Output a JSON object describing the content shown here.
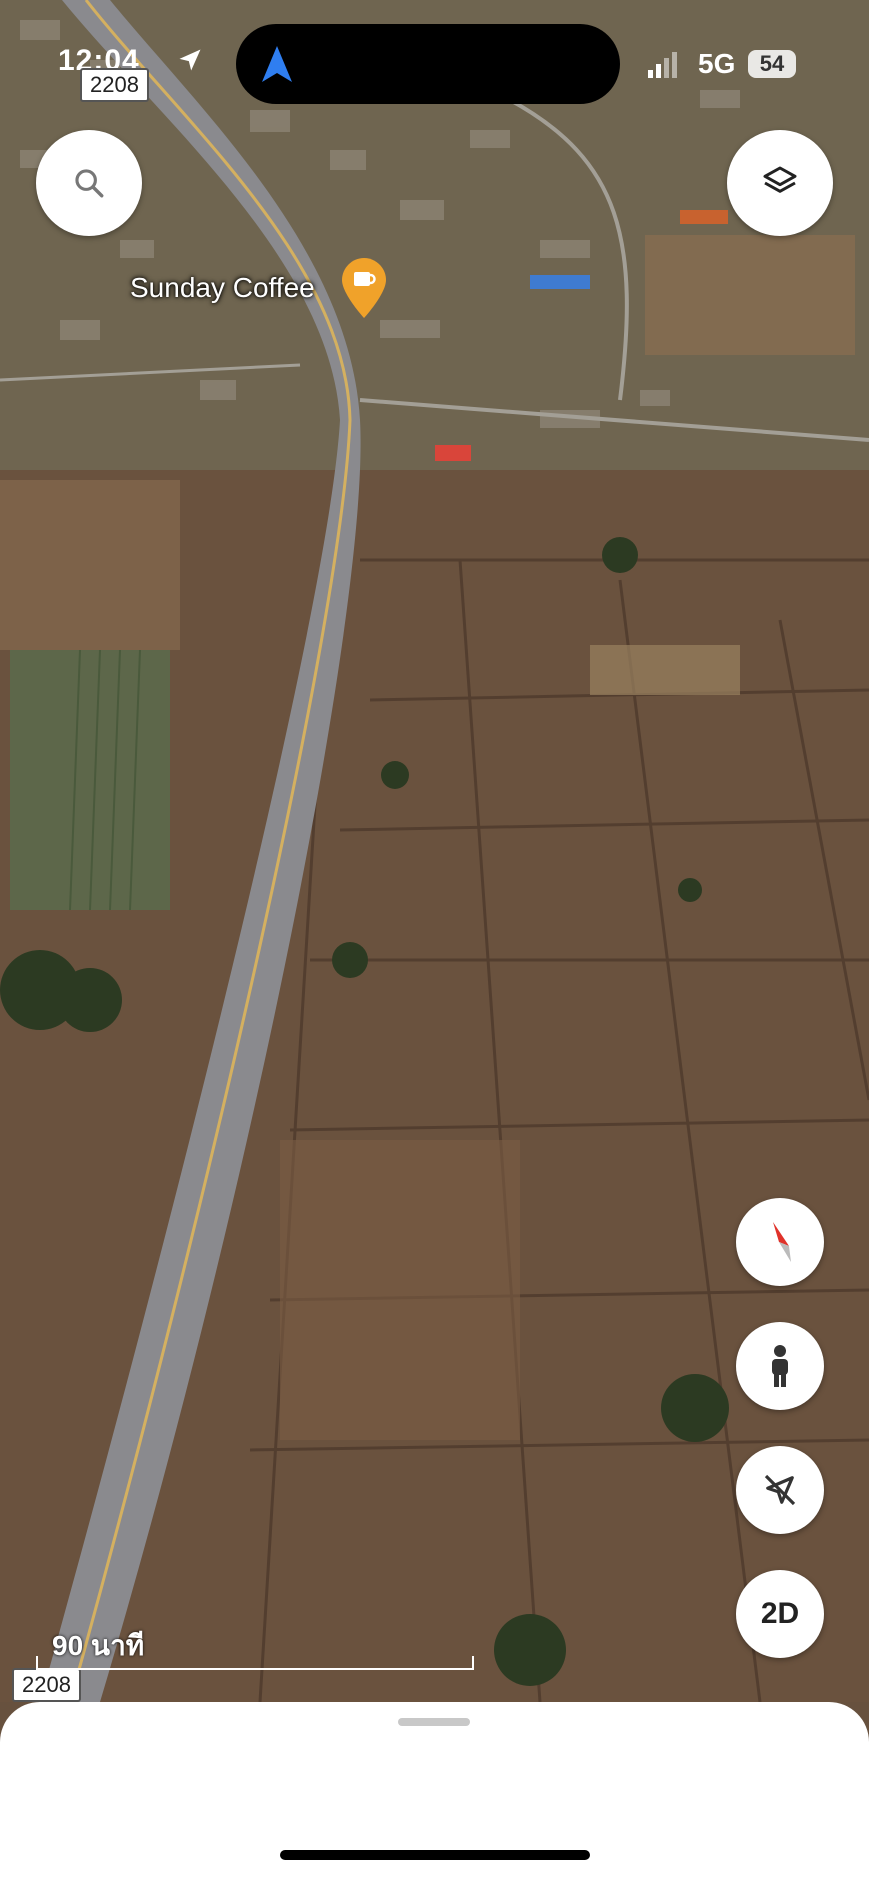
{
  "status_bar": {
    "time": "12:04",
    "network": "5G",
    "battery": "54"
  },
  "map": {
    "road_shield_top": "2208",
    "road_shield_bottom": "2208",
    "poi": {
      "name": "Sunday Coffee",
      "icon": "coffee-cup-icon"
    },
    "scale_label": "90 นาที"
  },
  "controls": {
    "search_icon": "search-icon",
    "layers_icon": "layers-icon",
    "compass_icon": "compass-icon",
    "street_view_icon": "pegman-icon",
    "location_icon": "location-off-icon",
    "view_mode_label": "2D"
  },
  "colors": {
    "accent_blue": "#2f7ef0",
    "poi_orange": "#f0a22a",
    "compass_red": "#e0322a"
  }
}
